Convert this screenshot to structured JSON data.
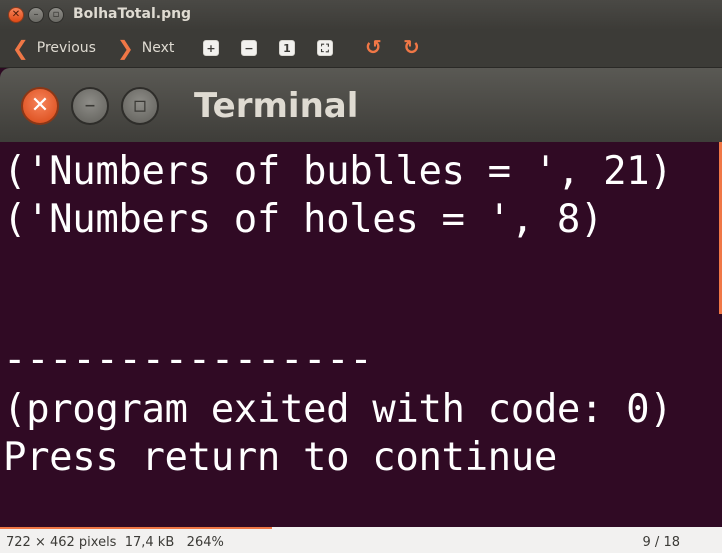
{
  "window": {
    "title": "BolhaTotal.png",
    "icons": {
      "close": "close-icon",
      "minimize": "minimize-icon",
      "maximize": "maximize-icon"
    }
  },
  "toolbar": {
    "previous_label": "Previous",
    "next_label": "Next",
    "tools": [
      "zoom-in-icon",
      "zoom-out-icon",
      "normal-size-icon",
      "best-fit-icon",
      "rotate-left-icon",
      "rotate-right-icon"
    ]
  },
  "image": {
    "terminal_title": "Terminal",
    "lines": [
      "('Numbers of bublles = ', 21)",
      "('Numbers of holes = ', 8)",
      "----------------",
      "(program exited with code: 0)",
      "Press return to continue"
    ]
  },
  "status": {
    "dimensions": "722 × 462 pixels",
    "size": "17,4 kB",
    "zoom": "264%",
    "page": "9 / 18",
    "progress_fraction": 0.5
  },
  "colors": {
    "accent": "#f07746",
    "terminal_bg": "#300a24",
    "chrome_bg": "#3c3b37"
  }
}
